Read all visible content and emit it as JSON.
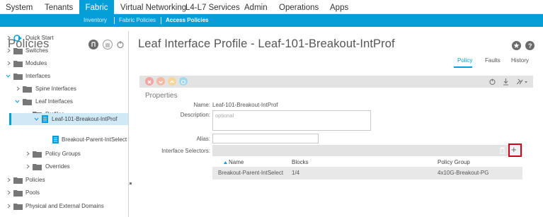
{
  "topnav": {
    "tabs": [
      {
        "label": "System"
      },
      {
        "label": "Tenants"
      },
      {
        "label": "Fabric"
      },
      {
        "label": "Virtual Networking"
      },
      {
        "label": "L4-L7 Services"
      },
      {
        "label": "Admin"
      },
      {
        "label": "Operations"
      },
      {
        "label": "Apps"
      }
    ],
    "active": "Fabric"
  },
  "subnav": {
    "items": [
      {
        "label": "Inventory"
      },
      {
        "label": "Fabric Policies"
      },
      {
        "label": "Access Policies"
      }
    ],
    "active": "Access Policies"
  },
  "sidebar": {
    "title": "Policies",
    "items": [
      {
        "label": "Quick Start",
        "icon": "quick-start-icon"
      },
      {
        "label": "Switches",
        "icon": "folder-icon"
      },
      {
        "label": "Modules",
        "icon": "folder-icon"
      },
      {
        "label": "Interfaces",
        "icon": "folder-icon"
      },
      {
        "label": "Spine Interfaces",
        "icon": "folder-icon"
      },
      {
        "label": "Leaf Interfaces",
        "icon": "folder-icon"
      },
      {
        "label": "Profiles",
        "icon": "folder-icon"
      },
      {
        "label": "Leaf-101-Breakout-IntProf",
        "icon": "document-icon"
      },
      {
        "label": "Breakout-Parent-IntSelect",
        "icon": "document-icon"
      },
      {
        "label": "Policy Groups",
        "icon": "folder-icon"
      },
      {
        "label": "Overrides",
        "icon": "folder-icon"
      },
      {
        "label": "Policies",
        "icon": "folder-icon"
      },
      {
        "label": "Pools",
        "icon": "folder-icon"
      },
      {
        "label": "Physical and External Domains",
        "icon": "folder-icon"
      }
    ],
    "selected": "Leaf-101-Breakout-IntProf"
  },
  "main": {
    "title": "Leaf Interface Profile - Leaf-101-Breakout-IntProf",
    "tabs": [
      {
        "label": "Policy"
      },
      {
        "label": "Faults"
      },
      {
        "label": "History"
      }
    ],
    "active_tab": "Policy",
    "properties_label": "Properties",
    "fields": {
      "name_label": "Name:",
      "name_value": "Leaf-101-Breakout-IntProf",
      "description_label": "Description:",
      "description_placeholder": "optional",
      "alias_label": "Alias:",
      "selectors_label": "Interface Selectors:"
    },
    "table": {
      "columns": [
        "Name",
        "Blocks",
        "Policy Group"
      ],
      "rows": [
        [
          "Breakout-Parent-IntSelect",
          "1/4",
          "4x10G-Breakout-PG"
        ]
      ]
    }
  },
  "colors": {
    "accent": "#049fd9",
    "highlight_border": "#d0021b"
  }
}
